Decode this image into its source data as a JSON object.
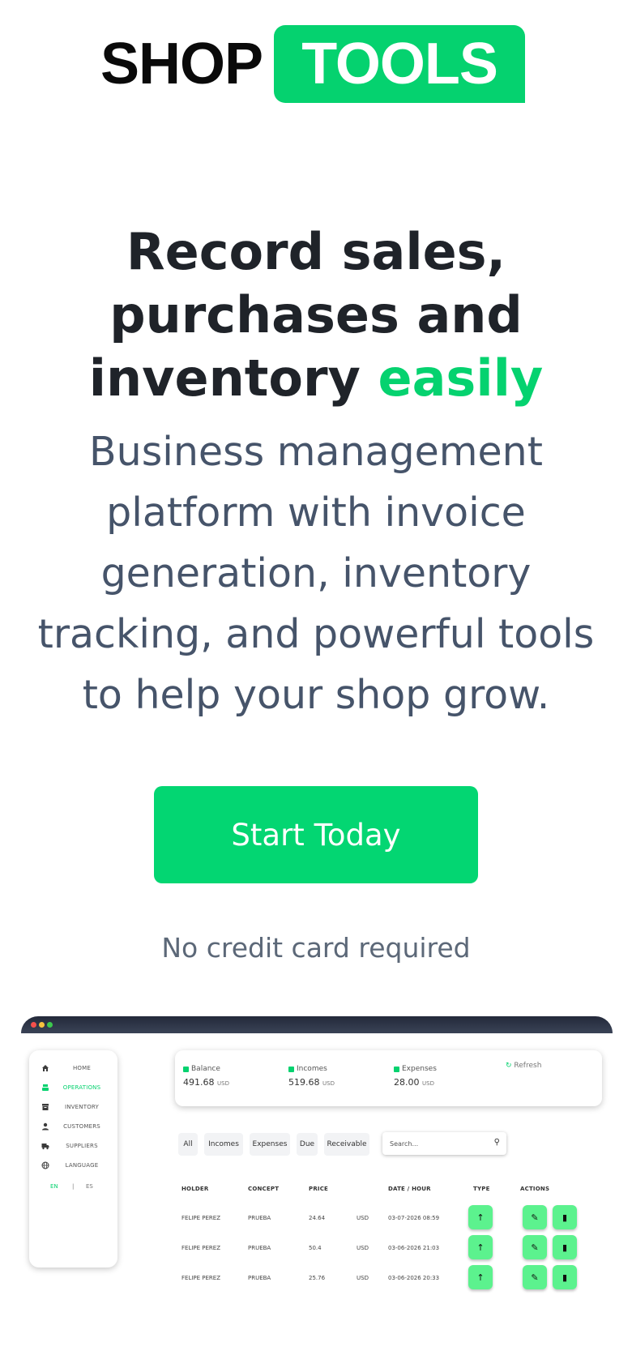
{
  "logo": {
    "part1": "SHOP",
    "part2": "TOOLS"
  },
  "hero": {
    "title_main": "Record sales, purchases and inventory",
    "title_accent": "easily",
    "subtitle": "Business management platform with invoice generation, inventory tracking, and powerful tools to help your shop grow.",
    "cta_label": "Start Today",
    "note": "No credit card required"
  },
  "colors": {
    "accent": "#05d26f",
    "heading": "#1f2329",
    "body": "#46546a"
  },
  "preview": {
    "sidebar": [
      {
        "label": "HOME",
        "icon": "home-icon"
      },
      {
        "label": "OPERATIONS",
        "icon": "register-icon",
        "active": true
      },
      {
        "label": "INVENTORY",
        "icon": "box-icon"
      },
      {
        "label": "CUSTOMERS",
        "icon": "person-icon"
      },
      {
        "label": "SUPPLIERS",
        "icon": "truck-icon"
      },
      {
        "label": "LANGUAGE",
        "icon": "globe-icon"
      }
    ],
    "languages": {
      "en": "EN",
      "sep": "|",
      "es": "ES"
    },
    "summary": [
      {
        "label": "Balance",
        "value": "491.68",
        "currency": "USD"
      },
      {
        "label": "Incomes",
        "value": "519.68",
        "currency": "USD"
      },
      {
        "label": "Expenses",
        "value": "28.00",
        "currency": "USD"
      }
    ],
    "refresh_label": "Refresh",
    "filters": [
      "All",
      "Incomes",
      "Expenses",
      "Due",
      "Receivable"
    ],
    "search_placeholder": "Search...",
    "columns": [
      "HOLDER",
      "CONCEPT",
      "PRICE",
      "DATE / HOUR",
      "TYPE",
      "ACTIONS"
    ],
    "rows": [
      {
        "holder": "FELIPE PEREZ",
        "concept": "PRUEBA",
        "price": "24.64",
        "currency": "USD",
        "date": "03-07-2026 08:59"
      },
      {
        "holder": "FELIPE PEREZ",
        "concept": "PRUEBA",
        "price": "50.4",
        "currency": "USD",
        "date": "03-06-2026 21:03"
      },
      {
        "holder": "FELIPE PEREZ",
        "concept": "PRUEBA",
        "price": "25.76",
        "currency": "USD",
        "date": "03-06-2026 20:33"
      }
    ]
  }
}
